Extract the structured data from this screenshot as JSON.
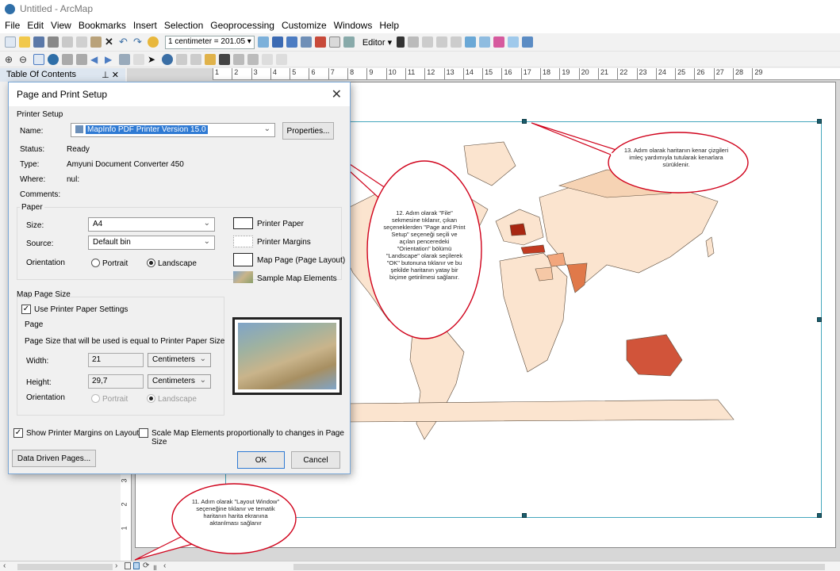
{
  "app": {
    "title": "Untitled - ArcMap"
  },
  "menu": [
    "File",
    "Edit",
    "View",
    "Bookmarks",
    "Insert",
    "Selection",
    "Geoprocessing",
    "Customize",
    "Windows",
    "Help"
  ],
  "toolbar": {
    "scale": "1 centimeter = 201.05 ▾",
    "editor": "Editor ▾"
  },
  "toc": {
    "title": "Table Of Contents",
    "pin": "⊥ ✕"
  },
  "ruler": {
    "h": [
      "1",
      "2",
      "3",
      "4",
      "5",
      "6",
      "7",
      "8",
      "9",
      "10",
      "11",
      "12",
      "13",
      "14",
      "15",
      "16",
      "17",
      "18",
      "19",
      "20",
      "21",
      "22",
      "23",
      "24",
      "25",
      "26",
      "27",
      "28",
      "29"
    ],
    "v": [
      "3",
      "2",
      "1"
    ]
  },
  "dialog": {
    "title": "Page and Print Setup",
    "printer_setup": "Printer Setup",
    "name_label": "Name:",
    "name_value": "MapInfo PDF Printer Version 15.0",
    "properties": "Properties...",
    "status_label": "Status:",
    "status_value": "Ready",
    "type_label": "Type:",
    "type_value": "Amyuni Document Converter 450",
    "where_label": "Where:",
    "where_value": "nul:",
    "comments_label": "Comments:",
    "paper": "Paper",
    "size_label": "Size:",
    "size_value": "A4",
    "source_label": "Source:",
    "source_value": "Default bin",
    "orientation_label": "Orientation",
    "portrait": "Portrait",
    "landscape": "Landscape",
    "legend": [
      "Printer Paper",
      "Printer Margins",
      "Map Page (Page Layout)",
      "Sample Map Elements"
    ],
    "map_page_size": "Map Page Size",
    "use_printer": "Use Printer Paper Settings",
    "page": "Page",
    "page_note": "Page Size that will be used is equal to Printer Paper Size",
    "width_label": "Width:",
    "width_value": "21",
    "width_unit": "Centimeters",
    "height_label": "Height:",
    "height_value": "29,7",
    "height_unit": "Centimeters",
    "orientation2_label": "Orientation",
    "portrait2": "Portrait",
    "landscape2": "Landscape",
    "show_margins": "Show Printer Margins on Layout",
    "scale_elements": "Scale Map Elements proportionally to changes in Page Size",
    "ddp": "Data Driven Pages...",
    "ok": "OK",
    "cancel": "Cancel"
  },
  "callouts": {
    "c12": "12. Adım olarak \"File\" sekmesine tıklanır, çıkan seçeneklerden \"Page and Print Setup\" seçeneği seçili ve açılan penceredeki \"Orientation\" bölümü \"Landscape\" olarak seçilerek \"OK\" butonuna tıklanır ve bu şekilde haritanın yatay bir biçime getirilmesi sağlanır.",
    "c13": "13. Adım olarak haritanın kenar çizgileri imleç yardımıyla tutularak kenarlara sürüklenir.",
    "c11": "11. Adım olarak \"Layout Window\" seçeneğine tıklanır ve tematik haritanın harita ekranına aktarılması sağlanır"
  },
  "colors": {
    "accent": "#2f7ad3",
    "frame": "#45a7bd",
    "callout_border": "#d0021b",
    "land": "#fbe4cf"
  }
}
